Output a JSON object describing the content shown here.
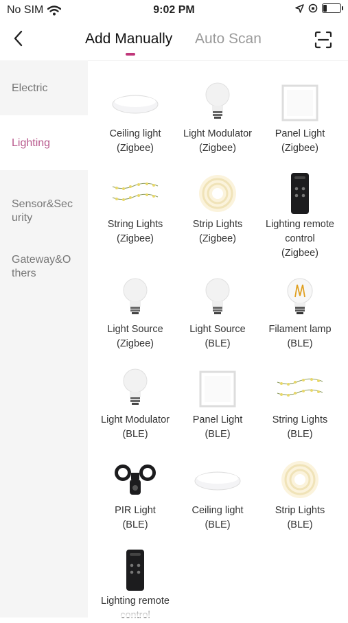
{
  "status": {
    "carrier": "No SIM",
    "time": "9:02 PM"
  },
  "nav": {
    "tab_manual": "Add Manually",
    "tab_scan": "Auto Scan"
  },
  "sidebar": {
    "items": [
      {
        "label": "Electric"
      },
      {
        "label": "Lighting"
      },
      {
        "label": "Sensor&Sec\nurity"
      },
      {
        "label": "Gateway&O\nthers"
      }
    ]
  },
  "devices": [
    {
      "icon": "ceiling-light-icon",
      "label": "Ceiling light\n(Zigbee)"
    },
    {
      "icon": "bulb-icon",
      "label": "Light Modulator\n(Zigbee)"
    },
    {
      "icon": "panel-light-icon",
      "label": "Panel Light\n(Zigbee)"
    },
    {
      "icon": "string-lights-icon",
      "label": "String Lights\n(Zigbee)"
    },
    {
      "icon": "strip-lights-icon",
      "label": "Strip Lights\n(Zigbee)"
    },
    {
      "icon": "remote-control-icon",
      "label": "Lighting remote\ncontrol\n(Zigbee)"
    },
    {
      "icon": "bulb-icon",
      "label": "Light Source\n(Zigbee)"
    },
    {
      "icon": "bulb-icon",
      "label": "Light Source\n(BLE)"
    },
    {
      "icon": "filament-lamp-icon",
      "label": "Filament lamp\n(BLE)"
    },
    {
      "icon": "bulb-icon",
      "label": "Light Modulator\n(BLE)"
    },
    {
      "icon": "panel-light-icon",
      "label": "Panel Light\n(BLE)"
    },
    {
      "icon": "string-lights-icon",
      "label": "String Lights\n(BLE)"
    },
    {
      "icon": "pir-light-icon",
      "label": "PIR Light\n(BLE)"
    },
    {
      "icon": "ceiling-light-icon",
      "label": "Ceiling light\n(BLE)"
    },
    {
      "icon": "strip-lights-icon",
      "label": "Strip Lights\n(BLE)"
    },
    {
      "icon": "remote-control-icon",
      "label": "Lighting remote\ncontrol"
    }
  ]
}
